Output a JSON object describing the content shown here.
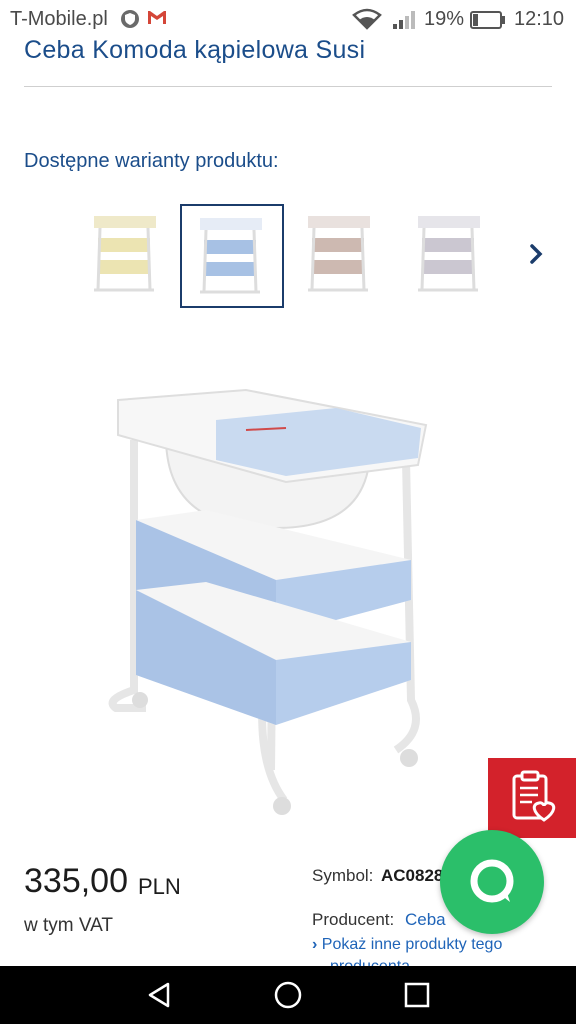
{
  "status_bar": {
    "carrier": "T-Mobile.pl",
    "battery_percent": "19%",
    "time": "12:10"
  },
  "product": {
    "title": "Ceba Komoda kąpielowa Susi",
    "variants_heading": "Dostępne warianty produktu:",
    "variants": [
      {
        "color": "#e9e3b8",
        "selected": false
      },
      {
        "color": "#a7c1e4",
        "selected": true
      },
      {
        "color": "#c9b4ac",
        "selected": false
      },
      {
        "color": "#c8c4cf",
        "selected": false
      }
    ],
    "price": "335,00",
    "currency": "PLN",
    "vat_note": "w tym VAT",
    "symbol_label": "Symbol:",
    "symbol_value": "AC0828",
    "producer_label": "Producent:",
    "producer_value": "Ceba",
    "show_other_products": "Pokaż inne produkty tego",
    "show_other_products_cont": "producenta"
  },
  "colors": {
    "brand_blue": "#1b4d8a",
    "link_blue": "#1f64b8",
    "wishlist_red": "#d3222b",
    "chat_green": "#2bbf6a"
  },
  "icons": {
    "shield": "shield-icon",
    "gmail": "gmail-icon",
    "wifi": "wifi-icon",
    "signal": "signal-icon",
    "battery": "battery-icon",
    "next": "chevron-right-icon",
    "wishlist": "clipboard-heart-icon",
    "chat": "chat-icon",
    "nav_back": "back-icon",
    "nav_home": "home-icon",
    "nav_recents": "recents-icon"
  }
}
